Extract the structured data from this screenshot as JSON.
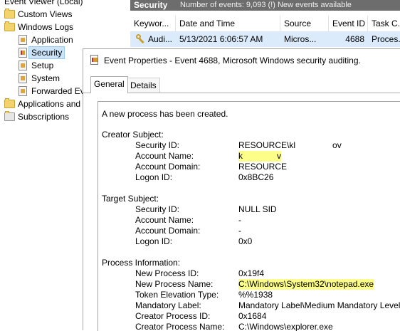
{
  "tree": {
    "root": "Event Viewer (Local)",
    "custom_views": "Custom Views",
    "windows_logs": "Windows Logs",
    "application": "Application",
    "security": "Security",
    "setup": "Setup",
    "system": "System",
    "forwarded": "Forwarded Ev",
    "apps_services": "Applications and",
    "subscriptions": "Subscriptions"
  },
  "header": {
    "title": "Security",
    "subtitle": "Number of events: 9,093 (!) New events available"
  },
  "columns": {
    "keywords": "Keywor...",
    "datetime": "Date and Time",
    "source": "Source",
    "event_id": "Event ID",
    "task": "Task C..."
  },
  "event_row": {
    "keywords": "Audi...",
    "datetime": "5/13/2021 6:06:57 AM",
    "source": "Micros...",
    "event_id": "4688",
    "task": "Proces..."
  },
  "dialog": {
    "title": "Event Properties - Event 4688, Microsoft Windows security auditing.",
    "tabs": {
      "general": "General",
      "details": "Details"
    },
    "intro": "A new process has been created.",
    "creator": {
      "heading": "Creator Subject:",
      "security_id_label": "Security ID:",
      "security_id_a": "RESOURCE\\kl",
      "security_id_b": "ov",
      "account_name_label": "Account Name:",
      "account_name_a": "k",
      "account_name_b": "v",
      "account_domain_label": "Account Domain:",
      "account_domain": "RESOURCE",
      "logon_id_label": "Logon ID:",
      "logon_id": "0x8BC26"
    },
    "target": {
      "heading": "Target Subject:",
      "security_id_label": "Security ID:",
      "security_id": "NULL SID",
      "account_name_label": "Account Name:",
      "account_name": "-",
      "account_domain_label": "Account Domain:",
      "account_domain": "-",
      "logon_id_label": "Logon ID:",
      "logon_id": "0x0"
    },
    "process": {
      "heading": "Process Information:",
      "new_pid_label": "New Process ID:",
      "new_pid": "0x19f4",
      "new_name_label": "New Process Name:",
      "new_name": "C:\\Windows\\System32\\notepad.exe",
      "token_label": "Token Elevation Type:",
      "token": "%%1938",
      "mandatory_label": "Mandatory Label:",
      "mandatory": "Mandatory Label\\Medium Mandatory Level",
      "creator_pid_label": "Creator Process ID:",
      "creator_pid": "0x1684",
      "creator_name_label": "Creator Process Name:",
      "creator_name": "C:\\Windows\\explorer.exe"
    }
  },
  "colors": {
    "highlight": "#fdfd8a",
    "selection": "#dcebfb",
    "header_bg": "#6d6d6d"
  }
}
